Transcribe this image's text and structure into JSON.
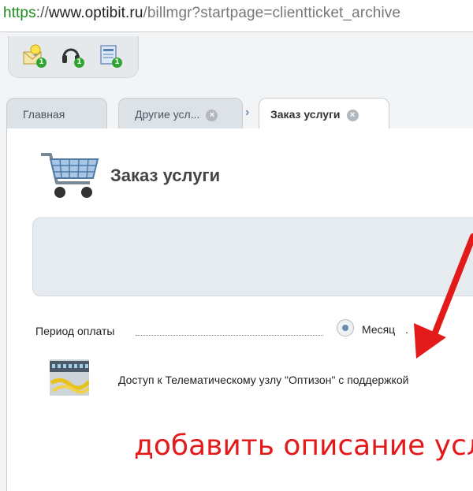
{
  "browser": {
    "url_protocol": "https",
    "url_separator": "://",
    "url_host": "www.optibit.ru",
    "url_path": "/billmgr?startpage=clientticket_archive"
  },
  "notifications": [
    {
      "icon": "envelope-bulb-icon",
      "count": "1"
    },
    {
      "icon": "headset-icon",
      "count": "1"
    },
    {
      "icon": "document-icon",
      "count": "1"
    }
  ],
  "tabs": [
    {
      "label": "Главная",
      "closable": false
    },
    {
      "label": "Другие усл...",
      "closable": true
    },
    {
      "label": "Заказ услуги",
      "closable": true,
      "active": true
    }
  ],
  "page": {
    "title": "Заказ услуги",
    "icon": "shopping-cart-icon"
  },
  "form": {
    "period_label": "Период оплаты",
    "period_option": "Месяц",
    "period_suffix": ".",
    "service_name": "Доступ к Телематическому узлу \"Оптизон\" с поддержкой"
  },
  "annotation": {
    "text": "добавить описание усл",
    "color": "#e31a1a"
  },
  "colors": {
    "accent": "#6a88b0",
    "badge": "#2ea52e",
    "url_protocol": "#1c8a1c"
  }
}
